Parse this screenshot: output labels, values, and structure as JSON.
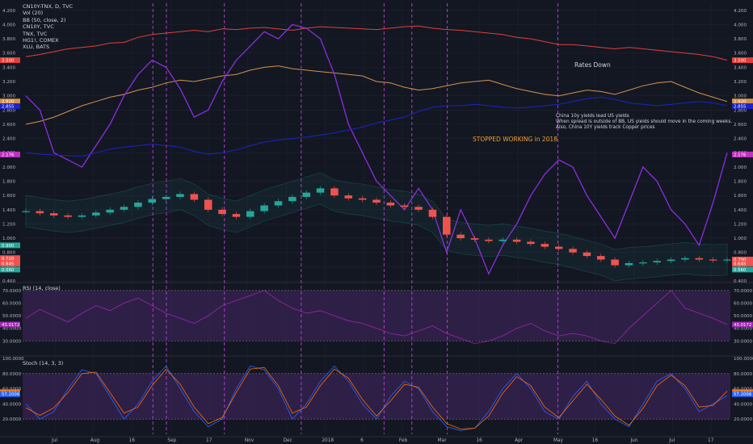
{
  "legend": {
    "symbol": "CN10Y-TNX, D, TVC",
    "items": [
      "Vol (20)",
      "BB (50, close, 2)",
      "CN10Y, TVC",
      "TNX, TVC",
      "HG1!, COMEX",
      "XLU, BATS"
    ]
  },
  "annotations": {
    "rates_down": "Rates Down",
    "stopped": "STOPPED WORKING in 2018",
    "note_line1": "China 10y yields lead US yields",
    "note_line2": "When spread is outside of BB, US yields should move in the coming weeks.",
    "note_line3": "Also, China 10Y yields track Copper prices"
  },
  "panes": {
    "rsi_label": "RSI (14, close)",
    "stoch_label": "Stoch (14, 3, 3)"
  },
  "colors": {
    "background": "#131722",
    "grid": "#1e2230",
    "red_line": "#e0403c",
    "orange_line": "#d2924f",
    "purple_line": "#8b2fe0",
    "blue_line": "#1e23c8",
    "candle_up": "#26a69a",
    "candle_down": "#ef5350",
    "vline": "#b845d6",
    "pane_fill": "#3b2456",
    "stoch_k": "#2962ff",
    "stoch_d": "#ff6d00"
  },
  "chart_data": [
    {
      "type": "line",
      "title": "CN10Y-TNX, D, TVC",
      "y_ticks_left": [
        "4.200",
        "4.000",
        "3.800",
        "3.600",
        "3.400",
        "3.200",
        "3.000",
        "2.800",
        "2.600",
        "2.400",
        "2.200",
        "2.000",
        "1.800",
        "1.600",
        "1.400",
        "1.200",
        "1.000",
        "0.800",
        "0.600",
        "0.400"
      ],
      "y_ticks_right": [
        "4.200",
        "4.000",
        "3.800",
        "3.600",
        "3.400",
        "3.200",
        "3.000",
        "2.800",
        "2.600",
        "2.400",
        "2.200",
        "2.000",
        "1.800",
        "1.600",
        "1.400",
        "1.200",
        "1.000",
        "0.800",
        "0.600",
        "0.400"
      ],
      "ylim": [
        0.4,
        4.3
      ],
      "x_ticks": [
        "Jul",
        "Aug",
        "16",
        "Sep",
        "17",
        "Nov",
        "Dec",
        "2018",
        "6",
        "Feb",
        "Mar",
        "16",
        "Apr",
        "May",
        "16",
        "Jun",
        "Jul",
        "17"
      ],
      "price_badges_left": [
        "3.500",
        "2.920",
        "2.855",
        "2.176",
        "0.900",
        "0.720",
        "0.645",
        "0.560"
      ],
      "price_badges_right": [
        "3.500",
        "2.920",
        "2.855",
        "2.176",
        "0.700",
        "0.645",
        "0.560"
      ],
      "vlines_x_fraction": [
        0.203,
        0.221,
        0.298,
        0.4,
        0.51,
        0.547,
        0.594,
        0.741
      ],
      "series": [
        {
          "name": "HG1!, COMEX",
          "values": [
            3.55,
            3.58,
            3.62,
            3.66,
            3.68,
            3.7,
            3.74,
            3.75,
            3.82,
            3.86,
            3.88,
            3.9,
            3.92,
            3.9,
            3.94,
            3.93,
            3.95,
            3.96,
            3.94,
            3.92,
            3.95,
            3.97,
            3.96,
            3.95,
            3.94,
            3.93,
            3.95,
            3.97,
            3.98,
            3.95,
            3.93,
            3.92,
            3.9,
            3.88,
            3.86,
            3.82,
            3.8,
            3.76,
            3.72,
            3.72,
            3.7,
            3.68,
            3.66,
            3.68,
            3.66,
            3.64,
            3.62,
            3.6,
            3.58,
            3.55,
            3.5
          ]
        },
        {
          "name": "XLU, BATS",
          "values": [
            2.6,
            2.64,
            2.7,
            2.78,
            2.86,
            2.92,
            2.98,
            3.02,
            3.08,
            3.12,
            3.18,
            3.22,
            3.2,
            3.24,
            3.28,
            3.3,
            3.36,
            3.4,
            3.42,
            3.38,
            3.36,
            3.34,
            3.32,
            3.3,
            3.28,
            3.2,
            3.18,
            3.12,
            3.08,
            3.1,
            3.14,
            3.18,
            3.2,
            3.22,
            3.16,
            3.1,
            3.06,
            3.02,
            3.0,
            3.04,
            3.08,
            3.06,
            3.02,
            3.08,
            3.14,
            3.18,
            3.2,
            3.12,
            3.04,
            2.98,
            2.92
          ]
        },
        {
          "name": "CN10Y-TNX",
          "values": [
            3.0,
            2.8,
            2.2,
            2.1,
            2.0,
            2.3,
            2.6,
            3.0,
            3.3,
            3.5,
            3.4,
            3.1,
            2.7,
            2.8,
            3.2,
            3.5,
            3.7,
            3.9,
            3.8,
            4.0,
            3.95,
            3.8,
            3.3,
            2.6,
            2.2,
            1.8,
            1.6,
            1.4,
            1.7,
            1.4,
            0.8,
            1.4,
            1.0,
            0.5,
            0.9,
            1.2,
            1.6,
            1.9,
            2.1,
            2.0,
            1.6,
            1.3,
            1.0,
            1.5,
            2.0,
            1.8,
            1.4,
            1.2,
            0.9,
            1.5,
            2.2
          ]
        },
        {
          "name": "TNX, TVC",
          "values": [
            2.2,
            2.18,
            2.17,
            2.16,
            2.15,
            2.2,
            2.25,
            2.28,
            2.3,
            2.32,
            2.3,
            2.28,
            2.22,
            2.18,
            2.2,
            2.24,
            2.3,
            2.35,
            2.38,
            2.4,
            2.42,
            2.45,
            2.48,
            2.52,
            2.56,
            2.62,
            2.66,
            2.7,
            2.78,
            2.84,
            2.86,
            2.86,
            2.88,
            2.86,
            2.84,
            2.83,
            2.84,
            2.86,
            2.88,
            2.92,
            2.96,
            2.98,
            2.95,
            2.9,
            2.88,
            2.86,
            2.88,
            2.9,
            2.92,
            2.9,
            2.86
          ]
        },
        {
          "name": "CN10Y-TNX price",
          "values": [
            1.38,
            1.35,
            1.32,
            1.3,
            1.32,
            1.36,
            1.4,
            1.44,
            1.5,
            1.55,
            1.58,
            1.62,
            1.54,
            1.4,
            1.34,
            1.3,
            1.38,
            1.46,
            1.52,
            1.58,
            1.64,
            1.7,
            1.6,
            1.56,
            1.54,
            1.5,
            1.46,
            1.44,
            1.4,
            1.3,
            1.05,
            1.0,
            0.98,
            0.96,
            0.98,
            0.95,
            0.92,
            0.88,
            0.85,
            0.8,
            0.75,
            0.7,
            0.62,
            0.65,
            0.66,
            0.68,
            0.7,
            0.72,
            0.7,
            0.69,
            0.7
          ]
        }
      ]
    },
    {
      "type": "line",
      "title": "RSI (14, close)",
      "y_ticks": [
        "70.0000",
        "60.0000",
        "50.0000",
        "40.0000",
        "30.0000"
      ],
      "ylim": [
        20,
        75
      ],
      "current_value": "43.0172",
      "values": [
        48,
        55,
        50,
        45,
        52,
        58,
        54,
        60,
        64,
        58,
        52,
        48,
        44,
        50,
        58,
        62,
        66,
        70,
        62,
        56,
        52,
        54,
        50,
        46,
        44,
        40,
        36,
        34,
        38,
        42,
        36,
        32,
        28,
        30,
        34,
        40,
        44,
        38,
        34,
        36,
        34,
        30,
        28,
        40,
        50,
        60,
        70,
        56,
        52,
        48,
        43
      ]
    },
    {
      "type": "line",
      "title": "Stoch (14, 3, 3)",
      "y_ticks": [
        "100.0000",
        "80.0000",
        "60.0000",
        "40.0000",
        "20.0000"
      ],
      "ylim": [
        0,
        100
      ],
      "current_values": [
        "51.2950",
        "57.2006"
      ],
      "series": [
        {
          "values": [
            40,
            20,
            30,
            60,
            85,
            80,
            50,
            20,
            40,
            70,
            90,
            60,
            30,
            10,
            20,
            60,
            90,
            85,
            60,
            20,
            40,
            70,
            90,
            70,
            40,
            20,
            50,
            70,
            60,
            30,
            10,
            5,
            8,
            30,
            60,
            80,
            60,
            30,
            20,
            50,
            70,
            40,
            20,
            10,
            40,
            70,
            80,
            60,
            30,
            40,
            51
          ]
        },
        {
          "values": [
            35,
            25,
            35,
            55,
            80,
            82,
            55,
            28,
            36,
            64,
            86,
            66,
            36,
            14,
            22,
            55,
            86,
            88,
            64,
            28,
            36,
            64,
            86,
            74,
            46,
            24,
            44,
            66,
            62,
            36,
            14,
            7,
            8,
            24,
            54,
            76,
            64,
            36,
            22,
            44,
            66,
            46,
            24,
            12,
            34,
            64,
            78,
            64,
            36,
            38,
            57
          ]
        }
      ]
    }
  ]
}
